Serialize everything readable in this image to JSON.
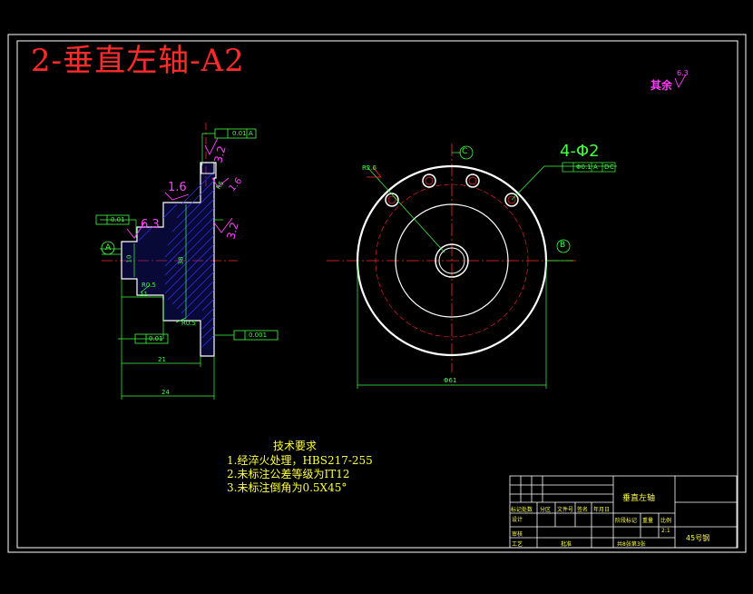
{
  "title": "2-垂直左轴-A2",
  "roughness_note": {
    "label": "其余",
    "value": "6.3"
  },
  "tech_requirements": {
    "heading": "技术要求",
    "items": [
      "1.经淬火处理，HBS217-255",
      "2.未标注公差等级为IT12",
      "3.未标注倒角为0.5X45°"
    ]
  },
  "section_view": {
    "datum_a": "A",
    "roughness": [
      "1.6",
      "6.3",
      "3.2",
      "3.2",
      "1.6"
    ],
    "tolerances": [
      "0.01",
      "0.01",
      "0.01",
      "0.001"
    ],
    "tolerance_datum": "A",
    "dims": [
      "11",
      "21",
      "24",
      "10",
      "R0.5",
      "R0.5",
      "38",
      "R5"
    ]
  },
  "front_view": {
    "datum_b": "B",
    "datum_c": "C",
    "hole_callout": "4-Φ2",
    "position_tolerance": [
      "Φ0.1",
      "A",
      "D",
      "C"
    ],
    "radius_label": "R2.6",
    "diameter": "Φ61"
  },
  "title_block": {
    "part_name": "垂直左轴",
    "material": "45号钢",
    "scale": "2:1",
    "sheet": "共8张第3张",
    "revision_headers": [
      "标记处数",
      "分区",
      "文件号",
      "签名",
      "年月日"
    ],
    "rows": [
      "设计",
      "审核",
      "工艺",
      "批准"
    ],
    "stage_headers": [
      "阶段标记",
      "重量",
      "比例"
    ]
  },
  "colors": {
    "background": "#000000",
    "frame": "#ffffff",
    "title": "#ff2a2a",
    "dimension": "#40ff40",
    "roughness": "#ff40ff",
    "centerline": "#ff2a2a",
    "part_outline": "#ffffff",
    "hatch": "#1a1aa0",
    "text": "#ffff40"
  }
}
